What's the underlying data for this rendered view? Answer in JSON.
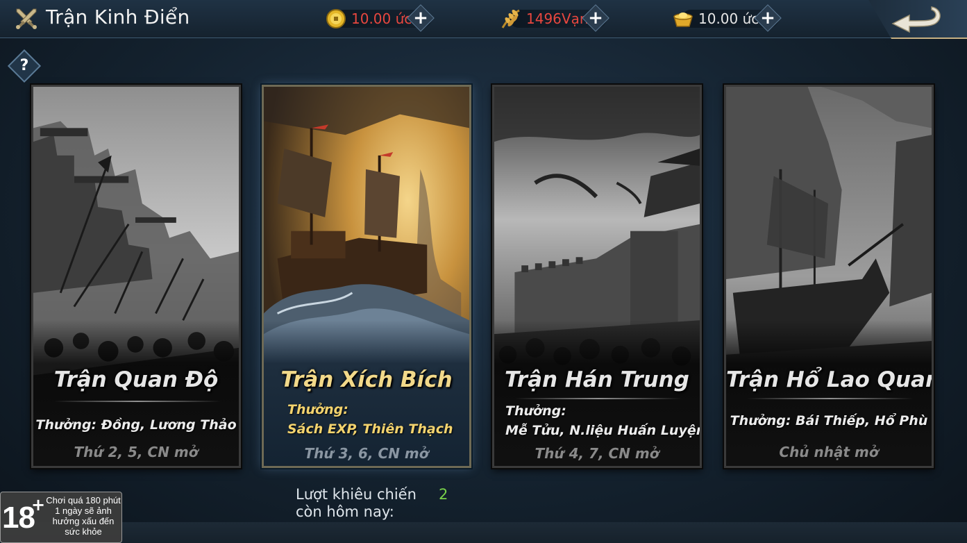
{
  "header": {
    "title": "Trận Kinh Điển",
    "resources": [
      {
        "icon": "gold-coin-icon",
        "value": "10.00 ức",
        "color": "#e8473f"
      },
      {
        "icon": "grain-leaf-icon",
        "value": "1496Vạn",
        "color": "#e8473f"
      },
      {
        "icon": "gold-ingot-icon",
        "value": "10.00 ức",
        "color": "#e6e6e6"
      }
    ],
    "plus": "+"
  },
  "help": {
    "label": "?"
  },
  "battles": [
    {
      "name": "Trận Quan Độ",
      "reward_lines": [
        "Thưởng: Đồng, Lương Thảo"
      ],
      "schedule": "Thứ 2, 5, CN mở"
    },
    {
      "name": "Trận Xích Bích",
      "reward_lines": [
        "Thưởng:",
        "Sách EXP, Thiên Thạch"
      ],
      "schedule": "Thứ 3, 6, CN mở"
    },
    {
      "name": "Trận Hán Trung",
      "reward_lines": [
        "Thưởng:",
        "Mễ Tửu, N.liệu Huấn Luyện"
      ],
      "schedule": "Thứ 4, 7, CN mở"
    },
    {
      "name": "Trận Hổ Lao Quan",
      "reward_lines": [
        "Thưởng: Bái Thiếp, Hổ Phù"
      ],
      "schedule": "Chủ nhật mở"
    }
  ],
  "attempts": {
    "label_line1": "Lượt khiêu chiến",
    "label_line2": "còn hôm nay:",
    "value": "2"
  },
  "age_notice": {
    "rating": "18",
    "plus": "+",
    "text": "Chơi quá 180 phút 1 ngày sẽ ảnh hưởng xấu đến sức khỏe"
  }
}
